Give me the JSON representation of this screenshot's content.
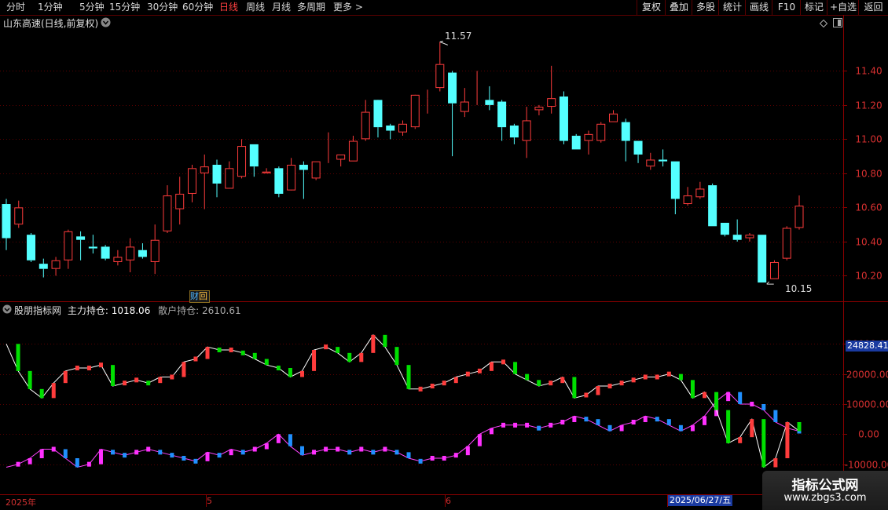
{
  "toolbar": {
    "periods": [
      "分时",
      "1分钟",
      "5分钟",
      "15分钟",
      "30分钟",
      "60分钟",
      "日线",
      "周线",
      "月线",
      "多周期",
      "更多"
    ],
    "active_period": "日线",
    "more_arrow": ">",
    "right_buttons": [
      "复权",
      "叠加",
      "多股",
      "统计",
      "画线",
      "F10",
      "标记",
      "+自选",
      "返回"
    ]
  },
  "main_chart": {
    "title": "山东高速(日线,前复权)",
    "high_label": "11.57",
    "low_label": "10.15",
    "event_marker": "财",
    "event_marker2": "回"
  },
  "indicator": {
    "name": "股朋指标网",
    "main_label": "主力持仓: ",
    "main_value": "1018.06",
    "retail_label": "散户持仓: ",
    "retail_value": "2610.61",
    "current_value_tag": "24828.41"
  },
  "time_axis": {
    "labels": [
      "2025年",
      "5",
      "6"
    ],
    "cursor_date": "2025/06/27/五"
  },
  "watermark": {
    "line1": "指标公式网",
    "line2": "www.zbgs3.com"
  },
  "colors": {
    "up": "#ff3c3c",
    "down": "#54ffff",
    "grid": "#5a0000",
    "axis_text": "#d83030",
    "main_line": "#ffffff",
    "retail_line": "#ff44ff",
    "green_bar": "#00e000",
    "blue_bar": "#2090ff",
    "magenta_bar": "#ff30ff"
  },
  "chart_data": [
    {
      "type": "candlestick",
      "title": "山东高速(日线,前复权)",
      "ylim": [
        10.05,
        11.65
      ],
      "y_ticks": [
        10.2,
        10.4,
        10.6,
        10.8,
        11.0,
        11.2,
        11.4
      ],
      "x_labels": [
        "2025年",
        "5",
        "6"
      ],
      "candles": [
        [
          10.62,
          10.42,
          10.65,
          10.35
        ],
        [
          10.5,
          10.6,
          10.64,
          10.48
        ],
        [
          10.44,
          10.29,
          10.45,
          10.28
        ],
        [
          10.27,
          10.24,
          10.3,
          10.19
        ],
        [
          10.24,
          10.29,
          10.31,
          10.2
        ],
        [
          10.29,
          10.46,
          10.47,
          10.24
        ],
        [
          10.43,
          10.41,
          10.46,
          10.29
        ],
        [
          10.37,
          10.36,
          10.44,
          10.33
        ],
        [
          10.37,
          10.3,
          10.38,
          10.29
        ],
        [
          10.28,
          10.31,
          10.35,
          10.26
        ],
        [
          10.29,
          10.37,
          10.42,
          10.22
        ],
        [
          10.35,
          10.31,
          10.39,
          10.3
        ],
        [
          10.28,
          10.41,
          10.5,
          10.21
        ],
        [
          10.46,
          10.67,
          10.73,
          10.45
        ],
        [
          10.59,
          10.68,
          10.78,
          10.5
        ],
        [
          10.68,
          10.83,
          10.85,
          10.63
        ],
        [
          10.8,
          10.84,
          10.91,
          10.59
        ],
        [
          10.85,
          10.74,
          10.88,
          10.66
        ],
        [
          10.71,
          10.83,
          10.87,
          10.73
        ],
        [
          10.78,
          10.96,
          11.0,
          10.77
        ],
        [
          10.97,
          10.84,
          10.97,
          10.78
        ],
        [
          10.8,
          10.81,
          10.83,
          10.8
        ],
        [
          10.83,
          10.68,
          10.84,
          10.66
        ],
        [
          10.7,
          10.85,
          10.89,
          10.71
        ],
        [
          10.85,
          10.82,
          10.87,
          10.65
        ],
        [
          10.77,
          10.87,
          10.87,
          10.76
        ],
        [
          10.88,
          10.88,
          11.04,
          10.86
        ],
        [
          10.88,
          10.91,
          10.91,
          10.84
        ],
        [
          10.87,
          10.99,
          11.02,
          10.87
        ],
        [
          11.0,
          11.16,
          11.23,
          10.99
        ],
        [
          11.23,
          11.07,
          11.21,
          11.01
        ],
        [
          11.08,
          11.05,
          11.09,
          11.0
        ],
        [
          11.04,
          11.09,
          11.11,
          11.02
        ],
        [
          11.07,
          11.26,
          11.25,
          11.06
        ],
        [
          11.24,
          11.24,
          11.29,
          11.15
        ],
        [
          11.3,
          11.44,
          11.57,
          11.28
        ],
        [
          11.39,
          11.21,
          11.4,
          10.9
        ],
        [
          11.16,
          11.22,
          11.3,
          11.13
        ],
        [
          11.22,
          11.22,
          11.4,
          11.2
        ],
        [
          11.23,
          11.2,
          11.31,
          11.17
        ],
        [
          11.22,
          11.07,
          11.23,
          10.99
        ],
        [
          11.08,
          11.01,
          11.09,
          10.97
        ],
        [
          10.99,
          11.11,
          11.19,
          10.89
        ],
        [
          11.17,
          11.19,
          11.2,
          11.14
        ],
        [
          11.19,
          11.24,
          11.43,
          11.15
        ],
        [
          11.25,
          10.99,
          11.28,
          10.97
        ],
        [
          11.02,
          10.94,
          11.03,
          10.94
        ],
        [
          10.99,
          11.03,
          11.05,
          10.91
        ],
        [
          10.99,
          11.09,
          11.1,
          10.98
        ],
        [
          11.1,
          11.15,
          11.17,
          11.1
        ],
        [
          11.1,
          10.99,
          11.12,
          10.87
        ],
        [
          10.99,
          10.91,
          10.99,
          10.86
        ],
        [
          10.84,
          10.88,
          10.92,
          10.82
        ],
        [
          10.88,
          10.87,
          10.94,
          10.84
        ],
        [
          10.87,
          10.65,
          10.87,
          10.56
        ],
        [
          10.62,
          10.67,
          10.72,
          10.61
        ],
        [
          10.66,
          10.71,
          10.75,
          10.65
        ],
        [
          10.73,
          10.49,
          10.74,
          10.49
        ],
        [
          10.51,
          10.44,
          10.51,
          10.43
        ],
        [
          10.44,
          10.41,
          10.53,
          10.4
        ],
        [
          10.42,
          10.44,
          10.45,
          10.4
        ],
        [
          10.44,
          10.16,
          10.44,
          10.16
        ],
        [
          10.18,
          10.28,
          10.29,
          10.18
        ],
        [
          10.3,
          10.48,
          10.49,
          10.29
        ],
        [
          10.48,
          10.61,
          10.67,
          10.47
        ]
      ]
    },
    {
      "type": "line+bar",
      "ylim": [
        -20000,
        40000
      ],
      "y_ticks": [
        -10000,
        0,
        10000,
        20000,
        30000
      ],
      "series": [
        {
          "name": "主力持仓",
          "values": [
            30000,
            21000,
            15000,
            12000,
            17000,
            21000,
            22000,
            22000,
            23000,
            16000,
            17000,
            18000,
            17000,
            19000,
            19000,
            24000,
            25000,
            29000,
            28000,
            28000,
            27000,
            25000,
            23000,
            22000,
            19000,
            21000,
            28000,
            29000,
            27000,
            24000,
            27000,
            33000,
            29000,
            23000,
            15000,
            15000,
            16000,
            17000,
            19000,
            20000,
            21000,
            24000,
            24000,
            20000,
            18000,
            16000,
            17000,
            19000,
            12000,
            13000,
            16000,
            16000,
            17000,
            18000,
            19000,
            19000,
            20000,
            18000,
            12000,
            14000,
            8000,
            -3000,
            -1000,
            5000,
            -11000,
            -8000,
            4000,
            1000
          ]
        },
        {
          "name": "散户持仓",
          "values": [
            -11000,
            -10000,
            -8000,
            -5000,
            -5000,
            -8000,
            -11000,
            -10000,
            -5000,
            -6000,
            -7000,
            -6000,
            -5000,
            -6000,
            -7000,
            -8000,
            -9000,
            -6000,
            -7000,
            -5000,
            -6000,
            -5000,
            -3000,
            0,
            -4000,
            -7000,
            -6000,
            -5000,
            -5000,
            -6000,
            -5000,
            -6000,
            -5000,
            -6000,
            -8000,
            -9000,
            -8000,
            -8000,
            -7000,
            -4000,
            0,
            2000,
            3000,
            3000,
            3000,
            2000,
            3000,
            4000,
            6000,
            5000,
            3000,
            1000,
            3000,
            4000,
            6000,
            5000,
            3000,
            1000,
            3000,
            6000,
            11000,
            14000,
            10000,
            10000,
            8000,
            4000,
            2000,
            1000
          ]
        }
      ]
    }
  ]
}
